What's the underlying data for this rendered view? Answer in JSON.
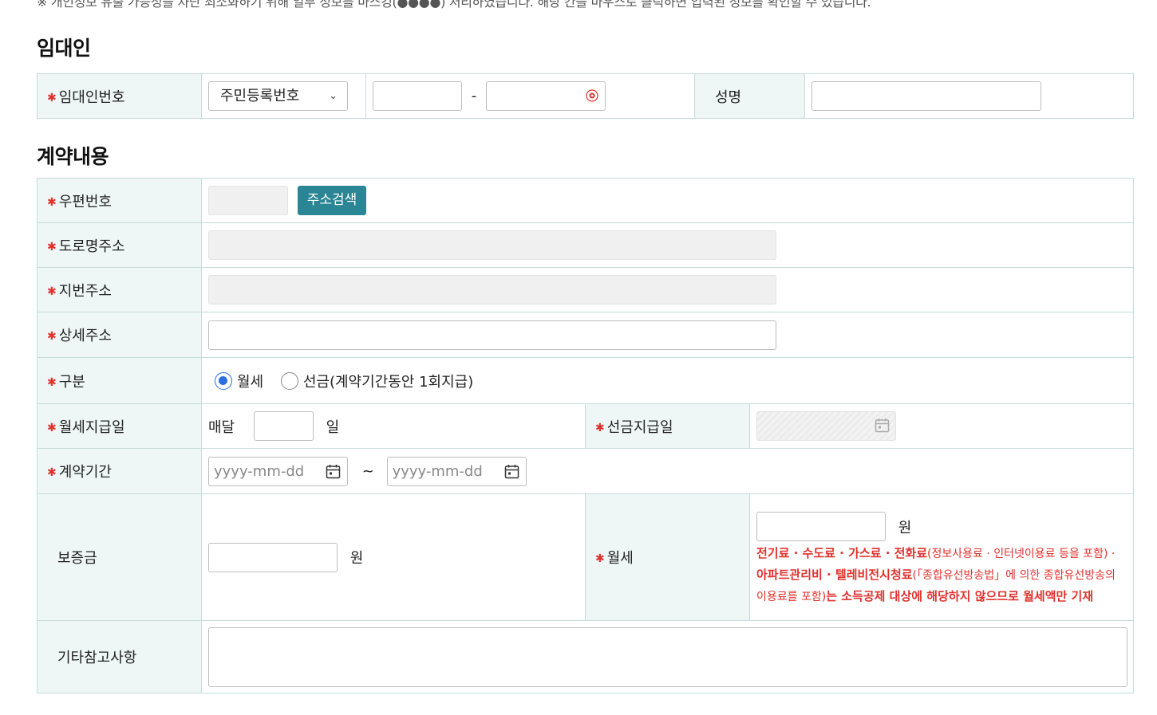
{
  "notice": "※ 개인정보 유출 가능성을 차단 최소화하기 위해 일부 정보를 마스킹(●●●●) 처리하였습니다. 해당 칸을 마우스로 클릭하면 입력된 정보를 확인할 수 있습니다.",
  "landlord": {
    "title": "임대인",
    "id_label": "임대인번호",
    "id_type_selected": "주민등록번호",
    "separator": "-",
    "name_label": "성명"
  },
  "contract": {
    "title": "계약내용",
    "zip_label": "우편번호",
    "address_search_button": "주소검색",
    "road_address_label": "도로명주소",
    "lot_address_label": "지번주소",
    "detail_address_label": "상세주소",
    "type_label": "구분",
    "type_options": [
      "월세",
      "선금(계약기간동안 1회지급)"
    ],
    "type_selected": "월세",
    "monthly_pay_day_label": "월세지급일",
    "monthly_prefix": "매달",
    "day_unit": "일",
    "prepay_date_label": "선금지급일",
    "period_label": "계약기간",
    "date_placeholder": "yyyy-mm-dd",
    "period_separator": "~",
    "deposit_label": "보증금",
    "won_unit": "원",
    "rent_label": "월세",
    "rent_note_1": "전기료 · 수도료 · 가스료 · 전화료",
    "rent_note_2": "(정보사용료 · 인터넷이용료 등을 포함) · ",
    "rent_note_3": "아파트관리비 · 텔레비전시청료",
    "rent_note_4": "(「종합유선방송법」에 의한 종합유선방송의 이용료를 포함)",
    "rent_note_5": "는 소득공제 대상에 해당하지 않으므로 월세액만 기재",
    "memo_label": "기타참고사항"
  },
  "colors": {
    "header_bg": "#eef7f6",
    "accent_button": "#2a8694",
    "required": "#e0322d",
    "radio_selected": "#2d6ee0"
  }
}
